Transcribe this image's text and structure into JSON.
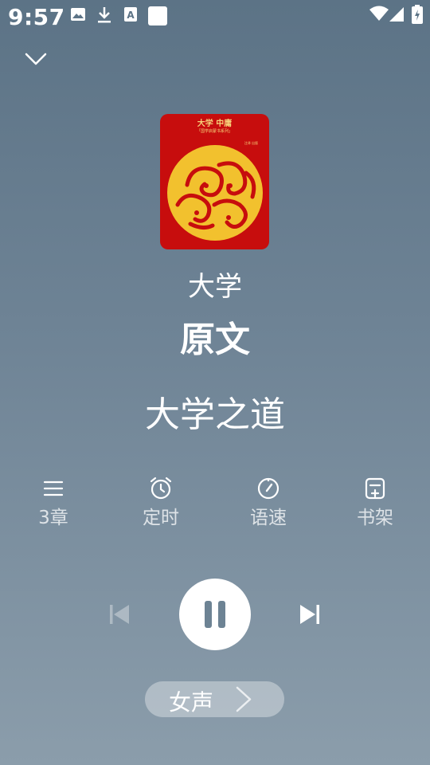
{
  "status_bar": {
    "time": "9:57",
    "icons": [
      "image-icon",
      "download-icon",
      "a-icon",
      "square-icon",
      "wifi-icon",
      "signal-icon",
      "battery-icon"
    ]
  },
  "player": {
    "cover": {
      "title": "大学 中庸",
      "subtitle": "「国学启蒙书系列」",
      "mini": "注译 出版"
    },
    "book_title": "大学",
    "chapter_title": "原文",
    "current_line": "大学之道",
    "tools": [
      {
        "label": "3章",
        "icon": "list-icon"
      },
      {
        "label": "定时",
        "icon": "alarm-icon"
      },
      {
        "label": "语速",
        "icon": "speed-icon"
      },
      {
        "label": "书架",
        "icon": "bookshelf-add-icon"
      }
    ],
    "voice_label": "女声"
  },
  "colors": {
    "background_top": "#5c7386",
    "background_bottom": "#8b9dab",
    "cover_red": "#c70d0d",
    "cover_gold": "#f6c63b"
  }
}
